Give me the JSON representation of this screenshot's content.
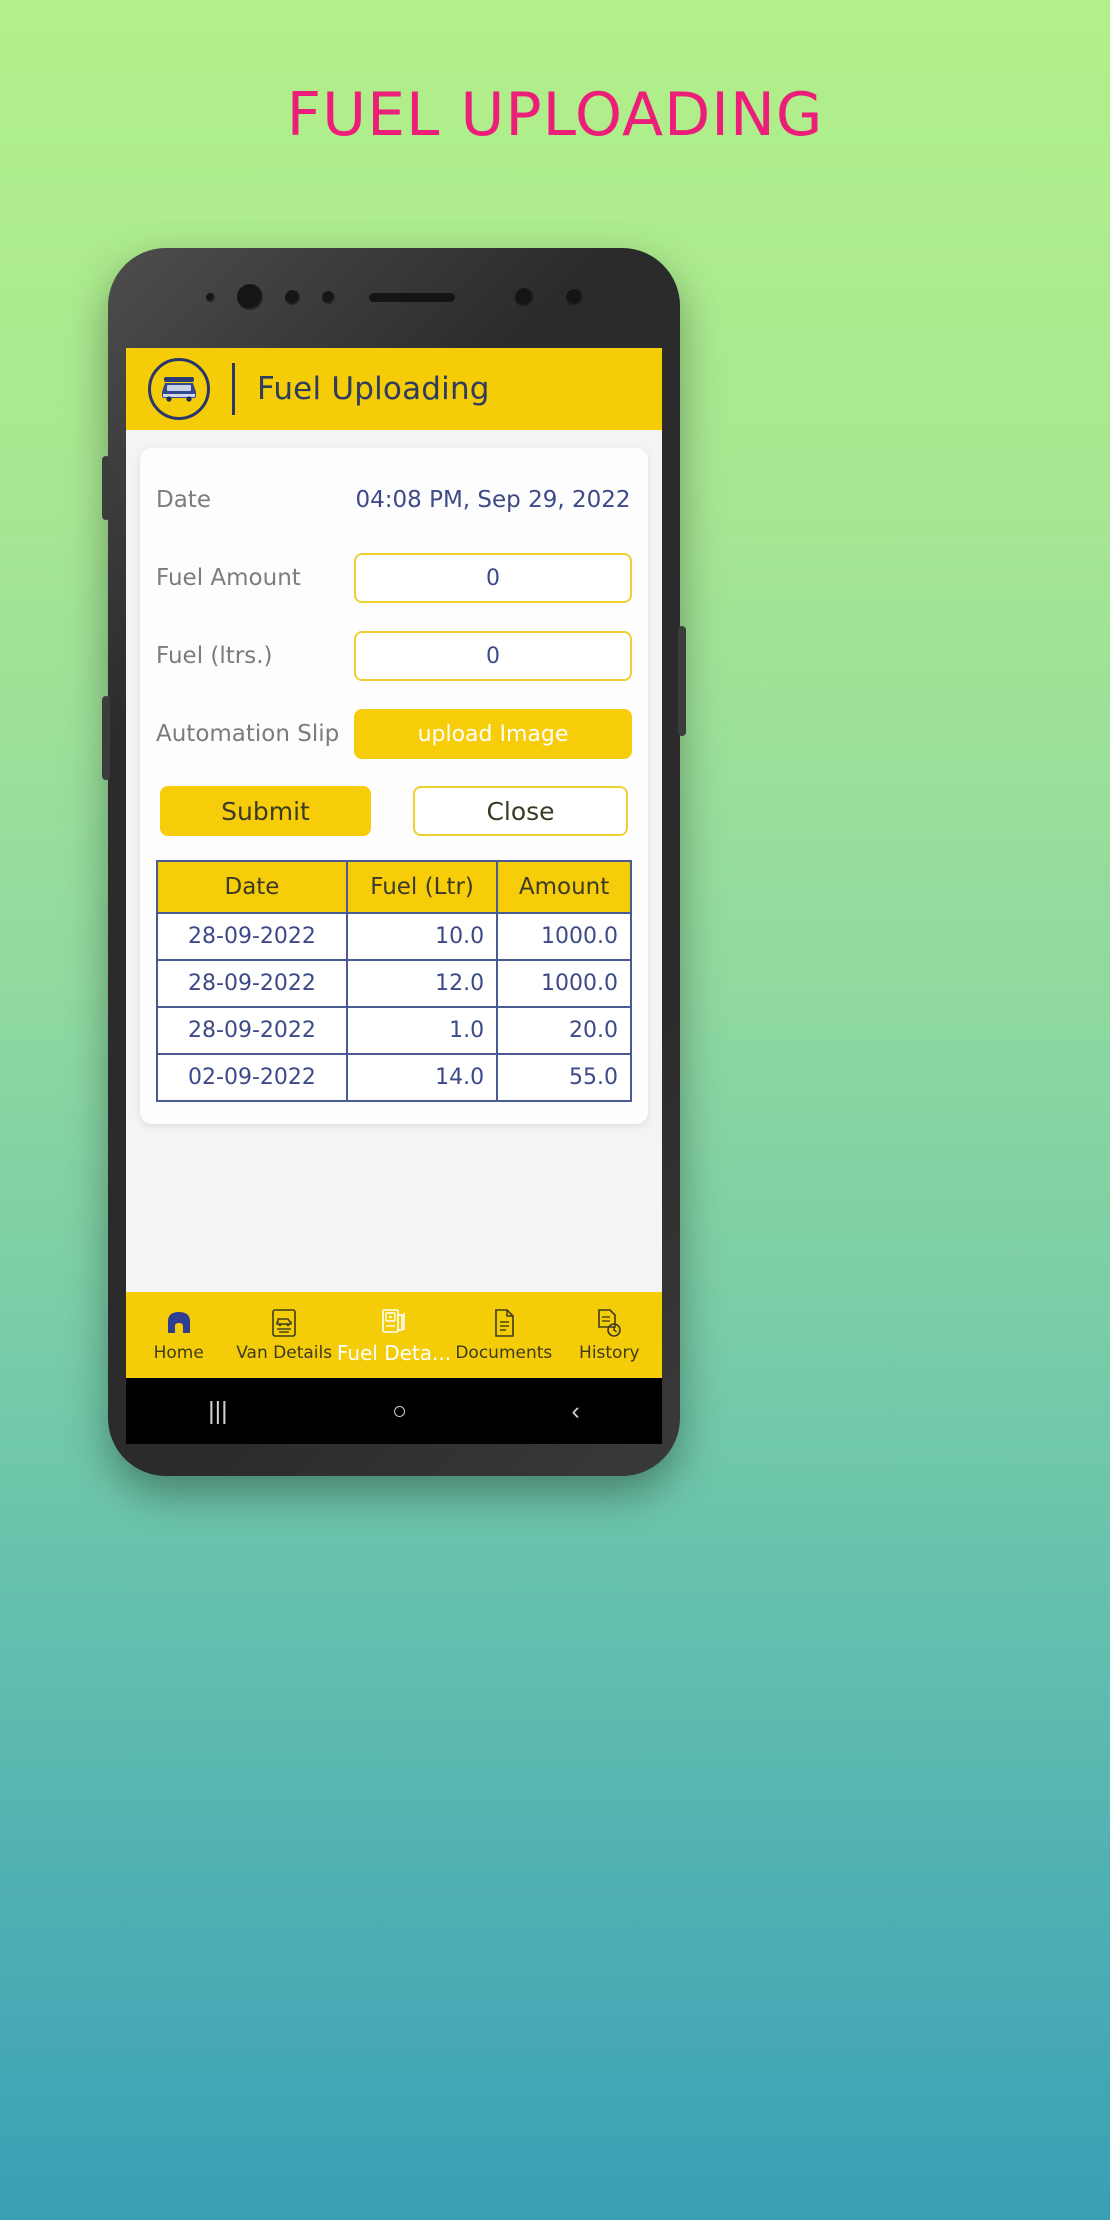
{
  "poster": {
    "title": "FUEL UPLOADING",
    "title_color": "#ed1e79",
    "background_top_color": "#b2f08a",
    "background_bottom_color": "#3a9fb5"
  },
  "app": {
    "accent_yellow": "#f5cc08",
    "navy": "#3d4a87",
    "header": {
      "title": "Fuel Uploading",
      "logo_icon": "van-in-circle-icon"
    },
    "form": {
      "date_label": "Date",
      "date_value": "04:08 PM, Sep 29, 2022",
      "fuel_amount_label": "Fuel Amount",
      "fuel_amount_value": "0",
      "fuel_amount_placeholder": "0",
      "fuel_ltrs_label": "Fuel (ltrs.)",
      "fuel_ltrs_value": "0",
      "fuel_ltrs_placeholder": "0",
      "automation_slip_label": "Automation Slip",
      "upload_button_label": "upload Image"
    },
    "actions": {
      "submit_label": "Submit",
      "close_label": "Close"
    },
    "table": {
      "headers": [
        "Date",
        "Fuel (Ltr)",
        "Amount"
      ],
      "rows": [
        {
          "date": "28-09-2022",
          "fuel": "10.0",
          "amount": "1000.0"
        },
        {
          "date": "28-09-2022",
          "fuel": "12.0",
          "amount": "1000.0"
        },
        {
          "date": "28-09-2022",
          "fuel": "1.0",
          "amount": "20.0"
        },
        {
          "date": "02-09-2022",
          "fuel": "14.0",
          "amount": "55.0"
        }
      ]
    },
    "bottom_nav": {
      "items": [
        {
          "label": "Home",
          "icon": "home-icon",
          "active": false
        },
        {
          "label": "Van Details",
          "icon": "van-card-icon",
          "active": false
        },
        {
          "label": "Fuel Deta...",
          "icon": "fuel-pump-icon",
          "active": true
        },
        {
          "label": "Documents",
          "icon": "document-icon",
          "active": false
        },
        {
          "label": "History",
          "icon": "history-icon",
          "active": false
        }
      ]
    },
    "system_nav": {
      "recents": "|||",
      "home": "○",
      "back": "‹"
    }
  }
}
